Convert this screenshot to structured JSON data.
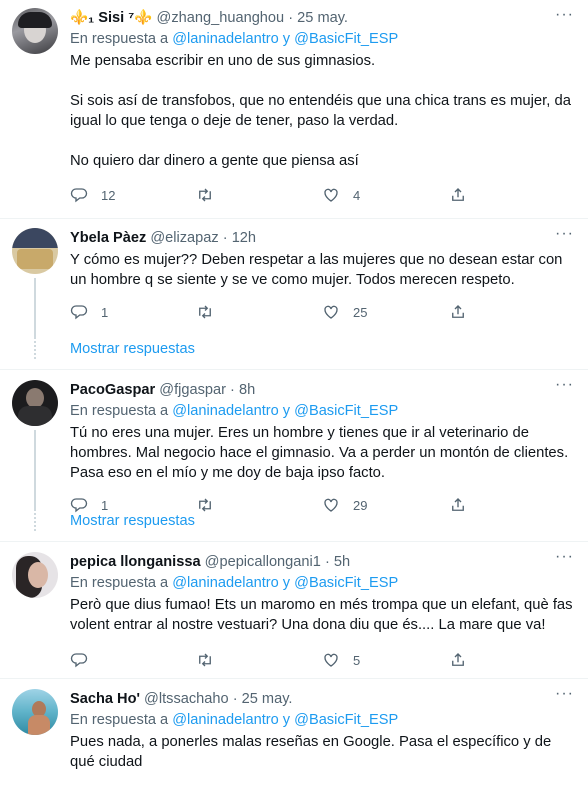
{
  "tweets": [
    {
      "name": "⚜️₁ Sisi ⁷⚜️",
      "handle": "@zhang_huanghou",
      "dot": "·",
      "time": "25 may.",
      "reply_prefix": "En respuesta a ",
      "reply_to": "@laninadelantro y @BasicFit_ESP",
      "text": "Me pensaba escribir en uno de sus gimnasios.\n\nSi sois así de transfobos, que no entendéis que una chica trans es mujer, da igual lo que tenga o deje de tener, paso la verdad.\n\nNo quiero dar dinero a gente que piensa así",
      "replies": "12",
      "retweets": "",
      "likes": "4"
    },
    {
      "name": "Ybela Pàez",
      "handle": "@elizapaz",
      "dot": "·",
      "time": "12h",
      "text": "Y cómo es mujer?? Deben respetar a las mujeres que no desean estar con un hombre q se siente y se ve como mujer. Todos merecen respeto.",
      "replies": "1",
      "retweets": "",
      "likes": "25",
      "show_replies": "Mostrar respuestas"
    },
    {
      "name": "PacoGaspar",
      "handle": "@fjgaspar",
      "dot": "·",
      "time": "8h",
      "reply_prefix": "En respuesta a ",
      "reply_to": "@laninadelantro y @BasicFit_ESP",
      "text": "Tú no eres una mujer. Eres un hombre y tienes que ir al veterinario de hombres. Mal negocio hace el gimnasio. Va a perder un montón de clientes. Pasa eso en el mío y me doy de baja ipso facto.",
      "replies": "1",
      "retweets": "",
      "likes": "29",
      "show_replies": "Mostrar respuestas"
    },
    {
      "name": "pepica llonganissa",
      "handle": "@pepicallongani1",
      "dot": "·",
      "time": "5h",
      "reply_prefix": "En respuesta a ",
      "reply_to": "@laninadelantro y @BasicFit_ESP",
      "text": "Però que dius fumao! Ets un maromo en més trompa que un elefant, què fas volent entrar al nostre vestuari? Una dona diu que és.... La mare que va!",
      "replies": "",
      "retweets": "",
      "likes": "5"
    },
    {
      "name": "Sacha Ho'",
      "handle": "@ltssachaho",
      "dot": "·",
      "time": "25 may.",
      "reply_prefix": "En respuesta a ",
      "reply_to": "@laninadelantro y @BasicFit_ESP",
      "text": "Pues nada, a ponerles malas reseñas en Google. Pasa el específico y de qué ciudad"
    }
  ],
  "more_glyph": "···",
  "colors": {
    "link": "#1d9bf0",
    "muted": "#536471",
    "border": "#eff3f4"
  }
}
